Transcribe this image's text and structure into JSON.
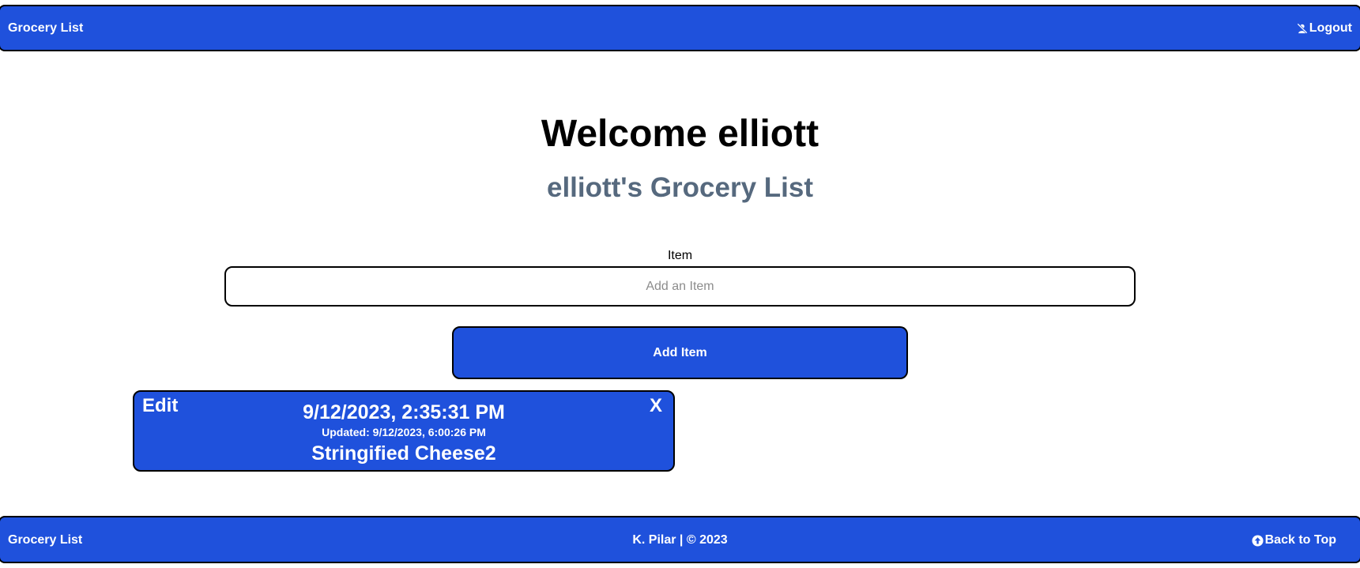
{
  "header": {
    "brand": "Grocery List",
    "logout_label": "Logout",
    "logout_icon": "user-slash-icon"
  },
  "main": {
    "welcome": "Welcome elliott",
    "list_title": "elliott's Grocery List",
    "item_label": "Item",
    "item_placeholder": "Add an Item",
    "item_value": "",
    "add_button_label": "Add Item"
  },
  "items": [
    {
      "edit_label": "Edit",
      "delete_label": "X",
      "created": "9/12/2023, 2:35:31 PM",
      "updated": "Updated: 9/12/2023, 6:00:26 PM",
      "name": "Stringified Cheese2"
    }
  ],
  "footer": {
    "brand": "Grocery List",
    "credit": "K. Pilar | © 2023",
    "back_to_top_label": "Back to Top",
    "back_to_top_icon": "arrow-up-circle-icon"
  },
  "colors": {
    "primary": "#1f51dc",
    "subtitle": "#56697e",
    "border": "#000000"
  }
}
